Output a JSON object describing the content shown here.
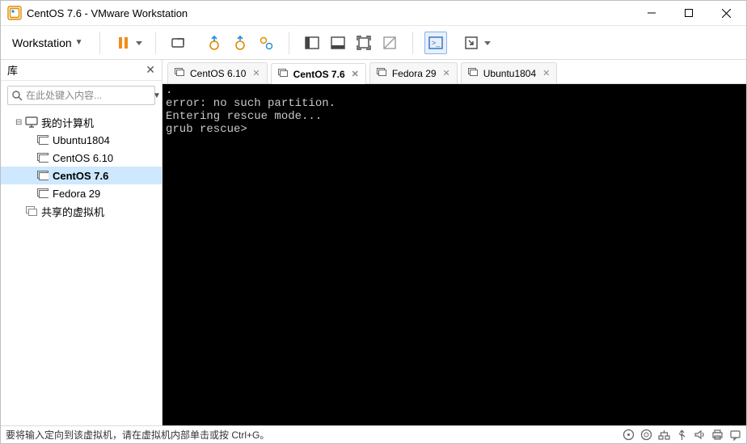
{
  "window_title": "CentOS 7.6 - VMware Workstation",
  "toolbar": {
    "workstation_menu": "Workstation"
  },
  "sidebar": {
    "header": "库",
    "search_placeholder": "在此处键入内容...",
    "root_label": "我的计算机",
    "vms": [
      {
        "label": "Ubuntu1804"
      },
      {
        "label": "CentOS 6.10"
      },
      {
        "label": "CentOS 7.6"
      },
      {
        "label": "Fedora 29"
      }
    ],
    "shared_label": "共享的虚拟机"
  },
  "tabs": [
    {
      "label": "CentOS 6.10"
    },
    {
      "label": "CentOS 7.6"
    },
    {
      "label": "Fedora 29"
    },
    {
      "label": "Ubuntu1804"
    }
  ],
  "console_lines": [
    ".",
    "error: no such partition.",
    "Entering rescue mode...",
    "grub rescue>"
  ],
  "statusbar_text": "要将输入定向到该虚拟机，请在虚拟机内部单击或按 Ctrl+G。"
}
